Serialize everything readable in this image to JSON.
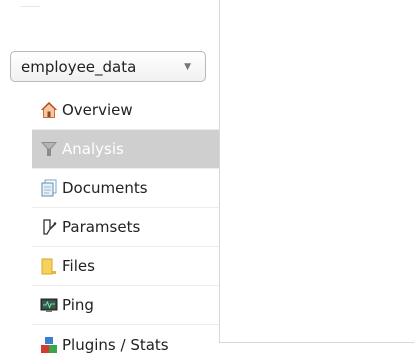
{
  "database_selector": {
    "value": "employee_data"
  },
  "nav": {
    "items": [
      {
        "label": "Overview",
        "icon": "home-icon",
        "active": false
      },
      {
        "label": "Analysis",
        "icon": "funnel-icon",
        "active": true
      },
      {
        "label": "Documents",
        "icon": "documents-icon",
        "active": false
      },
      {
        "label": "Paramsets",
        "icon": "paramsets-icon",
        "active": false
      },
      {
        "label": "Files",
        "icon": "folder-icon",
        "active": false
      },
      {
        "label": "Ping",
        "icon": "monitor-icon",
        "active": false
      },
      {
        "label": "Plugins / Stats",
        "icon": "plugins-icon",
        "active": false
      }
    ]
  },
  "colors": {
    "active_background": "#cfcfcf",
    "active_text": "#ffffff"
  }
}
